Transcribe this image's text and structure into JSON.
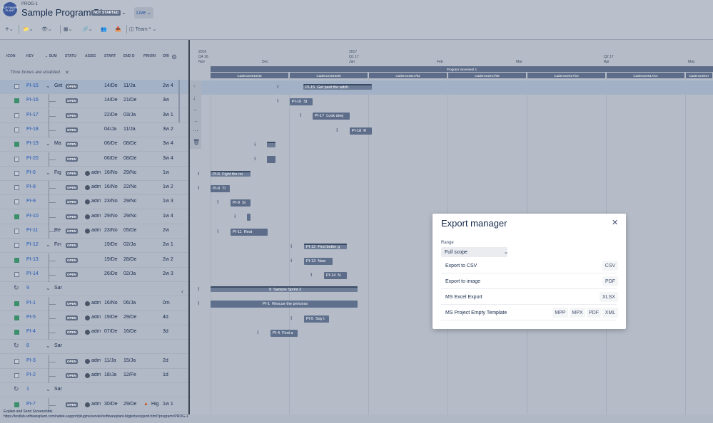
{
  "header": {
    "logo_text": "SOFTWARE PLANT",
    "program_key": "PROG-1",
    "program_title": "Sample Program PI",
    "status": "NOT STARTED",
    "live_label": "Live",
    "team_label": "Team"
  },
  "grid": {
    "columns": [
      "ICON",
      "KEY",
      "SUM",
      "STATU",
      "ASSIG",
      "START",
      "END D",
      "PRIORI",
      "ORI"
    ],
    "timebox_note": "Time boxes are enabled.",
    "rows": [
      {
        "kind": "task",
        "key": "PI-15",
        "summary": "Get",
        "status": "OPEN",
        "assignee": "",
        "start": "14/De",
        "end": "11/Ja",
        "priority": "",
        "duration": "2w 4",
        "chevron": true,
        "highlight": true
      },
      {
        "kind": "story",
        "key": "PI-16",
        "summary": "",
        "status": "OPEN",
        "assignee": "",
        "start": "14/De",
        "end": "21/De",
        "priority": "",
        "duration": "3w"
      },
      {
        "kind": "task",
        "key": "PI-17",
        "summary": "",
        "status": "OPEN",
        "assignee": "",
        "start": "22/De",
        "end": "03/Ja",
        "priority": "",
        "duration": "3w 1"
      },
      {
        "kind": "task",
        "key": "PI-18",
        "summary": "",
        "status": "OPEN",
        "assignee": "",
        "start": "04/Ja",
        "end": "11/Ja",
        "priority": "",
        "duration": "3w 2"
      },
      {
        "kind": "story",
        "key": "PI-19",
        "summary": "Ma",
        "status": "OPEN",
        "assignee": "",
        "start": "06/De",
        "end": "08/De",
        "priority": "",
        "duration": "3w 4",
        "chevron": true
      },
      {
        "kind": "task",
        "key": "PI-20",
        "summary": "",
        "status": "OPEN",
        "assignee": "",
        "start": "06/De",
        "end": "08/De",
        "priority": "",
        "duration": "3w 4"
      },
      {
        "kind": "task",
        "key": "PI-6",
        "summary": "Fig",
        "status": "OPEN",
        "assignee": "adm",
        "start": "16/No",
        "end": "29/No",
        "priority": "",
        "duration": "1w",
        "chevron": true
      },
      {
        "kind": "task",
        "key": "PI-8",
        "summary": "",
        "status": "OPEN",
        "assignee": "adm",
        "start": "16/No",
        "end": "22/No",
        "priority": "",
        "duration": "1w 2"
      },
      {
        "kind": "task",
        "key": "PI-9",
        "summary": "",
        "status": "OPEN",
        "assignee": "adm",
        "start": "23/No",
        "end": "29/No",
        "priority": "",
        "duration": "1w 3"
      },
      {
        "kind": "story",
        "key": "PI-10",
        "summary": "",
        "status": "OPEN",
        "assignee": "adm",
        "start": "29/No",
        "end": "29/No",
        "priority": "",
        "duration": "1w 4"
      },
      {
        "kind": "task",
        "key": "PI-11",
        "summary": "Re",
        "status": "OPEN",
        "assignee": "adm",
        "start": "23/No",
        "end": "05/De",
        "priority": "",
        "duration": "2w"
      },
      {
        "kind": "task",
        "key": "PI-12",
        "summary": "Fin",
        "status": "OPEN",
        "assignee": "",
        "start": "19/De",
        "end": "02/Ja",
        "priority": "",
        "duration": "2w 1",
        "chevron": true
      },
      {
        "kind": "story",
        "key": "PI-13",
        "summary": "",
        "status": "OPEN",
        "assignee": "",
        "start": "19/De",
        "end": "28/De",
        "priority": "",
        "duration": "2w 2"
      },
      {
        "kind": "task",
        "key": "PI-14",
        "summary": "",
        "status": "OPEN",
        "assignee": "",
        "start": "26/De",
        "end": "02/Ja",
        "priority": "",
        "duration": "2w 3"
      },
      {
        "kind": "sprint",
        "key": "9",
        "summary": "Sar",
        "status": "",
        "assignee": "",
        "start": "",
        "end": "",
        "priority": "",
        "duration": "",
        "chevron": true
      },
      {
        "kind": "story",
        "key": "PI-1",
        "summary": "",
        "status": "OPEN",
        "assignee": "adm",
        "start": "16/No",
        "end": "06/Ja",
        "priority": "",
        "duration": "0m"
      },
      {
        "kind": "story",
        "key": "PI-5",
        "summary": "",
        "status": "OPEN",
        "assignee": "adm",
        "start": "19/De",
        "end": "29/De",
        "priority": "",
        "duration": "4d"
      },
      {
        "kind": "story",
        "key": "PI-4",
        "summary": "",
        "status": "OPEN",
        "assignee": "adm",
        "start": "07/De",
        "end": "16/De",
        "priority": "",
        "duration": "3d"
      },
      {
        "kind": "sprint",
        "key": "8",
        "summary": "Sar",
        "status": "",
        "assignee": "",
        "start": "",
        "end": "",
        "priority": "",
        "duration": "",
        "chevron": true
      },
      {
        "kind": "task",
        "key": "PI-3",
        "summary": "",
        "status": "OPEN",
        "assignee": "adm",
        "start": "11/Ja",
        "end": "15/Ja",
        "priority": "",
        "duration": "2d"
      },
      {
        "kind": "task",
        "key": "PI-2",
        "summary": "",
        "status": "OPEN",
        "assignee": "adm",
        "start": "18/Ja",
        "end": "12/Fe",
        "priority": "",
        "duration": "1d"
      },
      {
        "kind": "sprint",
        "key": "1",
        "summary": "Sar",
        "status": "",
        "assignee": "",
        "start": "",
        "end": "",
        "priority": "",
        "duration": "",
        "chevron": true
      },
      {
        "kind": "story",
        "key": "PI-7",
        "summary": "",
        "status": "OPEN",
        "assignee": "adm",
        "start": "30/De",
        "end": "29/De",
        "priority": "Hig",
        "duration": "1w 1"
      }
    ]
  },
  "timeline": {
    "years": [
      {
        "label": "2016",
        "sub": "Q4 16"
      },
      {
        "label": "2017",
        "sub": "Q1 17"
      },
      {
        "label": "Q2 17",
        "sub": ""
      }
    ],
    "months": [
      "Nov",
      "Dec",
      "Jan",
      "Feb",
      "Mar",
      "Apr",
      "May"
    ],
    "program_increment": "Program Increment 1",
    "cadences": [
      "Cadence2016/46",
      "Cadence2016/50",
      "Cadence2017/02",
      "Cadence2017/06",
      "Cadence2017/10",
      "Cadence2017/14",
      "Cadence2017"
    ],
    "bars": [
      {
        "key": "PI-15",
        "label": "Get past the witch"
      },
      {
        "key": "PI-16",
        "label": "St"
      },
      {
        "key": "PI-17",
        "label": "Look deej"
      },
      {
        "key": "PI-18",
        "label": "R"
      },
      {
        "key": "PI-6",
        "label": "Fight the mi"
      },
      {
        "key": "PI-8",
        "label": "Tl"
      },
      {
        "key": "PI-9",
        "label": "Si"
      },
      {
        "key": "PI-11",
        "label": "Rest"
      },
      {
        "key": "PI-12",
        "label": "Find better g"
      },
      {
        "key": "PI-13",
        "label": "New"
      },
      {
        "key": "PI-14",
        "label": "N"
      },
      {
        "key": "9",
        "label": "Sample Sprint 2"
      },
      {
        "key": "PI-1",
        "label": "Rescue the princess"
      },
      {
        "key": "PI-5",
        "label": "Say t"
      },
      {
        "key": "PI-4",
        "label": "Find a"
      }
    ]
  },
  "export_manager": {
    "title": "Export manager",
    "range_label": "Range",
    "range_value": "Full scope",
    "options": [
      {
        "label": "Export to CSV",
        "buttons": [
          "CSV"
        ]
      },
      {
        "label": "Export to image",
        "buttons": [
          "PDF"
        ]
      },
      {
        "label": "MS Excel Export",
        "buttons": [
          "XLSX"
        ]
      },
      {
        "label": "MS Project Empty Template",
        "buttons": [
          "MPP",
          "MPX",
          "PDF",
          "XML"
        ]
      }
    ]
  },
  "statusbar": {
    "line1": "Explain and Send Screenshots",
    "line2": "https://testlab.softwareplant.com/radek-support/plugins/servlet/softwareplant-bigpicture/gantt.html?program=PROG-1"
  }
}
